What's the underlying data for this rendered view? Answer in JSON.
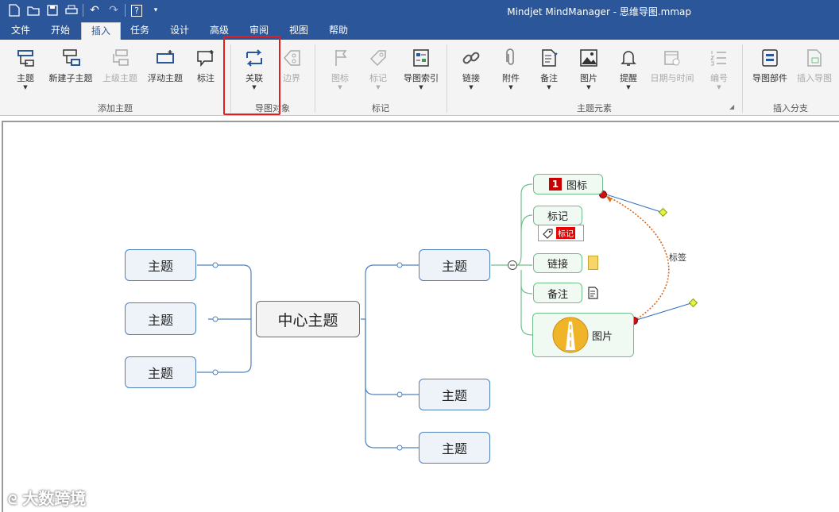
{
  "window": {
    "title": "Mindjet MindManager - 思维导图.mmap"
  },
  "tabs": [
    "文件",
    "开始",
    "插入",
    "任务",
    "设计",
    "高级",
    "审阅",
    "视图",
    "帮助"
  ],
  "ribbon": {
    "add_topic": {
      "label": "添加主题",
      "buttons": [
        "主题",
        "新建子主题",
        "上级主题",
        "浮动主题",
        "标注"
      ]
    },
    "map_objects": {
      "label": "导图对象",
      "buttons": [
        "关联",
        "边界"
      ]
    },
    "markers": {
      "label": "标记",
      "buttons": [
        "图标",
        "标记",
        "导图索引"
      ]
    },
    "topic_elements": {
      "label": "主题元素",
      "buttons": [
        "链接",
        "附件",
        "备注",
        "图片",
        "提醒",
        "日期与时间",
        "编号"
      ]
    },
    "insert_branch": {
      "label": "插入分支",
      "buttons": [
        "导图部件",
        "插入导图"
      ]
    }
  },
  "map": {
    "center": "中心主题",
    "left_topics": [
      "主题",
      "主题",
      "主题"
    ],
    "right_topics": [
      "主题",
      "主题",
      "主题"
    ],
    "subtopics": {
      "icon": "图标",
      "marker": "标记",
      "marker_tag": "标记",
      "link": "链接",
      "note": "备注",
      "image": "图片"
    },
    "icon_number": "1",
    "relation_label": "标签"
  },
  "watermark": "大数跨境",
  "colors": {
    "titlebar": "#2b579a",
    "highlight": "#e02020",
    "topic_border": "#4f81bd",
    "subtopic_border": "#6fbf8a",
    "relation": "#e07020"
  }
}
